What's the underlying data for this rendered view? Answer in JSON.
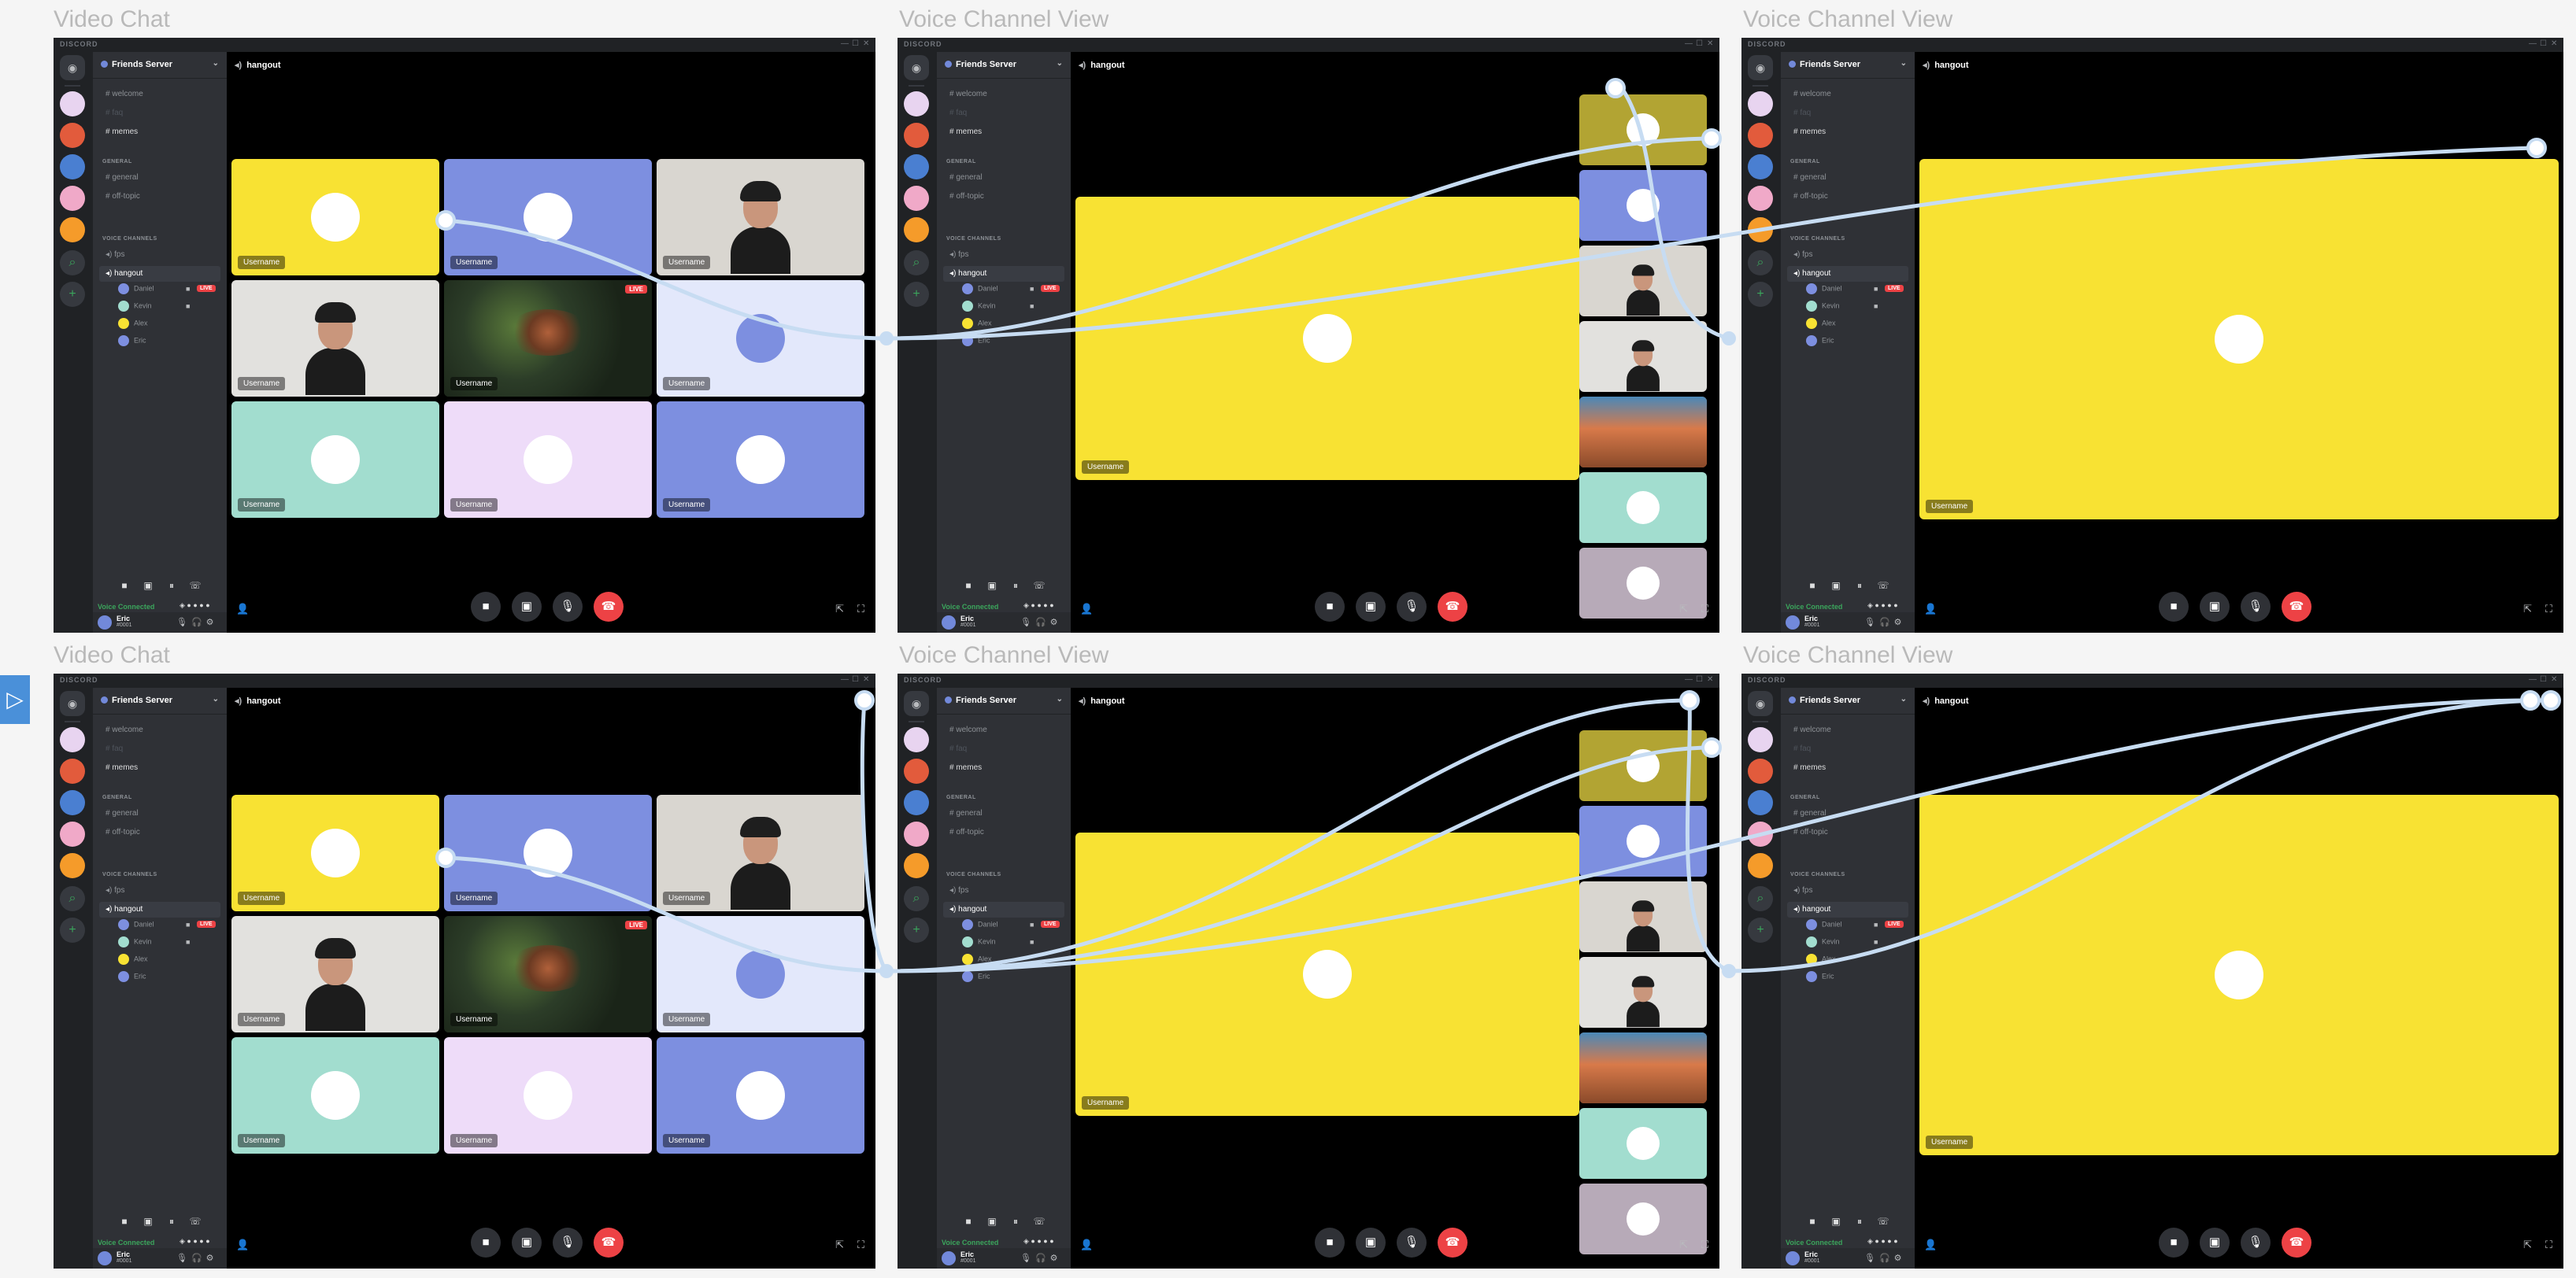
{
  "frames": [
    {
      "title": "Video Chat",
      "view": "grid",
      "variant": 1
    },
    {
      "title": "Voice Channel View",
      "view": "focus",
      "variant": 1
    },
    {
      "title": "Voice Channel View",
      "view": "full",
      "variant": 1
    },
    {
      "title": "Video Chat",
      "view": "grid",
      "variant": 2
    },
    {
      "title": "Voice Channel View",
      "view": "focus",
      "variant": 2
    },
    {
      "title": "Voice Channel View",
      "view": "full",
      "variant": 2
    }
  ],
  "app": {
    "window_title": "DISCORD",
    "server_name": "Friends Server",
    "channel_name": "hangout",
    "text_channels": [
      {
        "name": "welcome",
        "state": "normal"
      },
      {
        "name": "faq",
        "state": "muted"
      },
      {
        "name": "memes",
        "state": "bright"
      }
    ],
    "categories": {
      "general": "GENERAL",
      "voice": "VOICE CHANNELS"
    },
    "general_channels": [
      "general",
      "off-topic"
    ],
    "voice_channels": [
      "fps",
      "hangout"
    ],
    "voice_users": [
      {
        "name": "Daniel",
        "live": "LIVE",
        "camera": true
      },
      {
        "name": "Kevin",
        "live": "",
        "camera": true
      },
      {
        "name": "Alex",
        "live": "",
        "camera": false
      },
      {
        "name": "Eric",
        "live": "",
        "camera": false
      }
    ],
    "voice_status": "Voice Connected",
    "user": {
      "name": "Eric",
      "tag": "#0001"
    },
    "tile_label": "Username",
    "live_label": "LIVE"
  },
  "tiles": [
    {
      "kind": "avatar",
      "bg": "#f8e233",
      "face": "#ffffff"
    },
    {
      "kind": "avatar",
      "bg": "#7d8fe0",
      "face": "#ffffff"
    },
    {
      "kind": "person",
      "bg": "#d9d6d0"
    },
    {
      "kind": "person",
      "bg": "#e2e1de"
    },
    {
      "kind": "game",
      "bg": "#1a2418",
      "live": true
    },
    {
      "kind": "avatar",
      "bg": "#e3e8fb",
      "face": "#7d8fe0"
    },
    {
      "kind": "avatar",
      "bg": "#a2ddcf",
      "face": "#ffffff"
    },
    {
      "kind": "avatar",
      "bg": "#eedcf9",
      "face": "#ffffff"
    },
    {
      "kind": "avatar",
      "bg": "#7d8fe0",
      "face": "#ffffff"
    }
  ],
  "strip_tiles": [
    {
      "kind": "avatar",
      "bg": "#b2a433"
    },
    {
      "kind": "avatar",
      "bg": "#7d8fe0"
    },
    {
      "kind": "person",
      "bg": "#d9d6d0"
    },
    {
      "kind": "person",
      "bg": "#e2e1de"
    },
    {
      "kind": "game2",
      "bg": "#c87a4a"
    },
    {
      "kind": "avatar",
      "bg": "#a2ddcf"
    },
    {
      "kind": "avatar",
      "bg": "#b7aab8"
    }
  ],
  "colors": {
    "focus_yellow": "#f8e233",
    "discord_dark": "#202225",
    "sidebar": "#2f3136",
    "hangup_red": "#ed4245",
    "connector": "#c7dcf2",
    "play_button": "#4a90d9"
  },
  "icons": {
    "play": "▷",
    "camera": "■",
    "share": "▣",
    "mic": "🎙",
    "hangup": "☎",
    "speaker": "🔊",
    "hash": "#"
  }
}
